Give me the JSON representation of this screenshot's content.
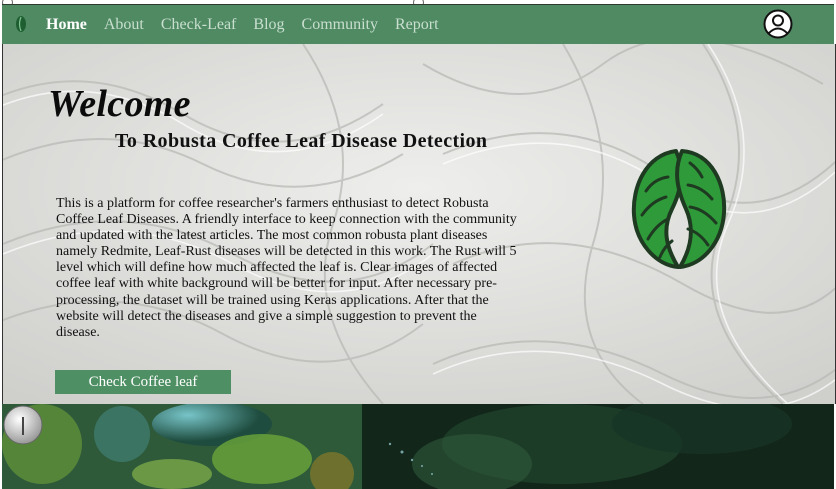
{
  "nav": {
    "items": [
      {
        "label": "Home",
        "active": true
      },
      {
        "label": "About",
        "active": false
      },
      {
        "label": "Check-Leaf",
        "active": false
      },
      {
        "label": "Blog",
        "active": false
      },
      {
        "label": "Community",
        "active": false
      },
      {
        "label": "Report",
        "active": false
      }
    ],
    "user_icon": "user-circle-icon",
    "logo_icon": "leaf-logo-icon"
  },
  "hero": {
    "welcome": "Welcome",
    "subtitle": "To Robusta Coffee Leaf Disease Detection",
    "description": "This is a platform for coffee researcher's farmers enthusiast to detect Robusta Coffee Leaf Diseases. A friendly interface to keep connection with the community and updated with the latest articles. The most common robusta plant diseases namely Redmite, Leaf-Rust diseases will be detected in this work. The Rust will 5 level which will define how much affected the leaf is. Clear images of affected coffee leaf with white background will be better for input. After necessary pre-processing, the dataset will be trained using Keras applications. After that the website will detect the diseases and give a simple suggestion to prevent the disease.",
    "cta_label": "Check Coffee leaf",
    "logo_icon": "coffee-bean-leaf-icon"
  },
  "colors": {
    "nav_bg": "#4f8a63",
    "button_bg": "#4e8f63",
    "leaf_green": "#2f9a3a",
    "dark_green": "#1e3b22"
  }
}
